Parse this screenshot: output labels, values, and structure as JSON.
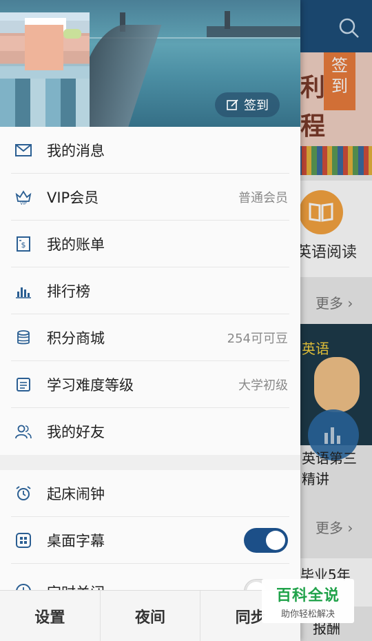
{
  "background": {
    "banner_text": "利\n程",
    "ribbon_text": "签到",
    "read_label": "英语阅读",
    "more_label": "更多",
    "card2_title": "英语",
    "card2_caption_line1": "英语第三",
    "card2_caption_line2": "精讲",
    "card3_text": "毕业5年",
    "card3_sub": "报酬"
  },
  "drawer": {
    "checkin_label": "签到",
    "menu_group1": [
      {
        "label": "我的消息",
        "value": "",
        "icon": "envelope-icon"
      },
      {
        "label": "VIP会员",
        "value": "普通会员",
        "icon": "crown-icon"
      },
      {
        "label": "我的账单",
        "value": "",
        "icon": "bill-icon"
      },
      {
        "label": "排行榜",
        "value": "",
        "icon": "bar-chart-icon"
      },
      {
        "label": "积分商城",
        "value": "254可可豆",
        "icon": "coins-icon"
      },
      {
        "label": "学习难度等级",
        "value": "大学初级",
        "icon": "document-icon"
      },
      {
        "label": "我的好友",
        "value": "",
        "icon": "friends-icon"
      }
    ],
    "menu_group2": [
      {
        "label": "起床闹钟",
        "icon": "alarm-icon"
      },
      {
        "label": "桌面字幕",
        "icon": "grid-icon",
        "toggle": "on"
      },
      {
        "label": "定时关闭",
        "icon": "clock-icon",
        "toggle": "off"
      }
    ]
  },
  "bottom_bar": {
    "settings": "设置",
    "night": "夜间",
    "sync": "同步"
  },
  "watermark": {
    "title": "百科全说",
    "subtitle": "助你轻松解决"
  },
  "colors": {
    "accent": "#1c4f88",
    "topbar": "#1e4f7a",
    "icon": "#2a5e92"
  }
}
